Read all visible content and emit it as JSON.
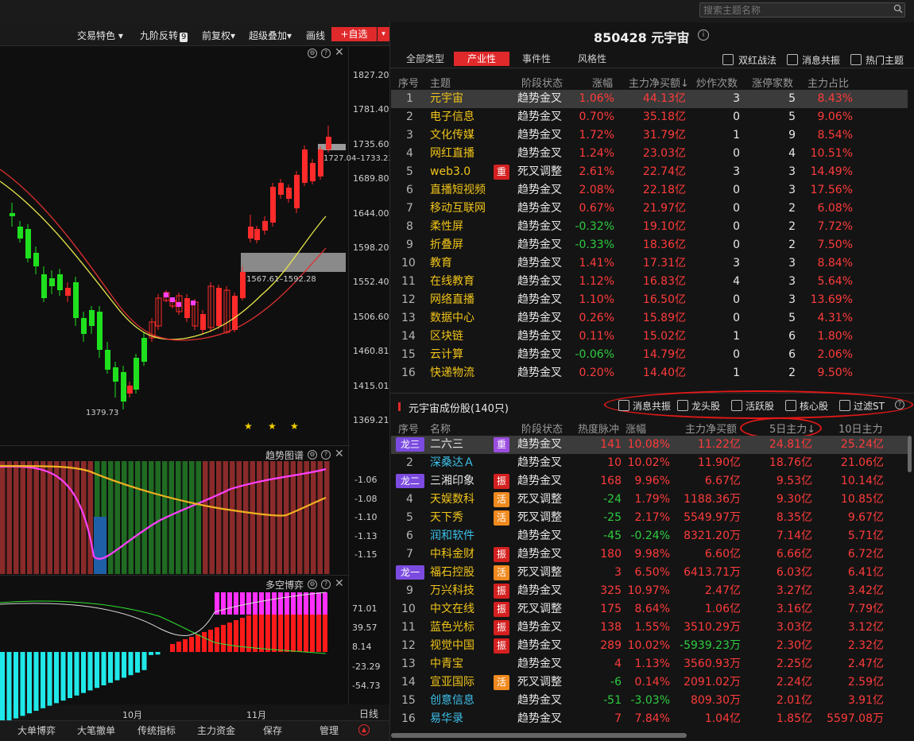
{
  "search": {
    "placeholder": "搜索主题名称"
  },
  "toolbar": {
    "items": [
      "交易特色 ▾",
      "九阶反转",
      "前复权▾",
      "超级叠加▾",
      "画线"
    ],
    "badge": "9",
    "add_label": "+自选",
    "add_dd": "▾"
  },
  "stock": {
    "code_name": "850428 元宇宙"
  },
  "tabs": [
    "全部类型",
    "产业性",
    "事件性",
    "风格性"
  ],
  "filters_top": [
    "双红战法",
    "消息共振",
    "热门主题"
  ],
  "theme_table": {
    "headers": [
      "序号",
      "主题",
      "阶段状态",
      "涨幅",
      "主力净买额↓",
      "炒作次数",
      "涨停家数",
      "主力占比"
    ],
    "rows": [
      {
        "no": "1",
        "name": "元宇宙",
        "tag": "",
        "state": "趋势金叉",
        "chg": "1.06%",
        "net": "44.13亿",
        "times": "3",
        "limit": "5",
        "ratio": "8.43%"
      },
      {
        "no": "2",
        "name": "电子信息",
        "tag": "",
        "state": "趋势金叉",
        "chg": "0.70%",
        "net": "35.18亿",
        "times": "0",
        "limit": "5",
        "ratio": "9.06%"
      },
      {
        "no": "3",
        "name": "文化传媒",
        "tag": "",
        "state": "趋势金叉",
        "chg": "1.72%",
        "net": "31.79亿",
        "times": "1",
        "limit": "9",
        "ratio": "8.54%"
      },
      {
        "no": "4",
        "name": "网红直播",
        "tag": "",
        "state": "趋势金叉",
        "chg": "1.24%",
        "net": "23.03亿",
        "times": "0",
        "limit": "4",
        "ratio": "10.51%"
      },
      {
        "no": "5",
        "name": "web3.0",
        "tag": "重",
        "state": "死叉调整",
        "chg": "2.61%",
        "net": "22.74亿",
        "times": "3",
        "limit": "3",
        "ratio": "14.49%"
      },
      {
        "no": "6",
        "name": "直播短视频",
        "tag": "",
        "state": "趋势金叉",
        "chg": "2.08%",
        "net": "22.18亿",
        "times": "0",
        "limit": "3",
        "ratio": "17.56%"
      },
      {
        "no": "7",
        "name": "移动互联网",
        "tag": "",
        "state": "趋势金叉",
        "chg": "0.67%",
        "net": "21.97亿",
        "times": "0",
        "limit": "2",
        "ratio": "6.08%"
      },
      {
        "no": "8",
        "name": "柔性屏",
        "tag": "",
        "state": "趋势金叉",
        "chg": "-0.32%",
        "net": "19.10亿",
        "times": "0",
        "limit": "2",
        "ratio": "7.72%"
      },
      {
        "no": "9",
        "name": "折叠屏",
        "tag": "",
        "state": "趋势金叉",
        "chg": "-0.33%",
        "net": "18.36亿",
        "times": "0",
        "limit": "2",
        "ratio": "7.50%"
      },
      {
        "no": "10",
        "name": "教育",
        "tag": "",
        "state": "趋势金叉",
        "chg": "1.41%",
        "net": "17.31亿",
        "times": "3",
        "limit": "3",
        "ratio": "8.84%"
      },
      {
        "no": "11",
        "name": "在线教育",
        "tag": "",
        "state": "趋势金叉",
        "chg": "1.12%",
        "net": "16.83亿",
        "times": "4",
        "limit": "3",
        "ratio": "5.64%"
      },
      {
        "no": "12",
        "name": "网络直播",
        "tag": "",
        "state": "趋势金叉",
        "chg": "1.10%",
        "net": "16.50亿",
        "times": "0",
        "limit": "3",
        "ratio": "13.69%"
      },
      {
        "no": "13",
        "name": "数据中心",
        "tag": "",
        "state": "趋势金叉",
        "chg": "0.26%",
        "net": "15.89亿",
        "times": "0",
        "limit": "5",
        "ratio": "4.31%"
      },
      {
        "no": "14",
        "name": "区块链",
        "tag": "",
        "state": "趋势金叉",
        "chg": "0.11%",
        "net": "15.02亿",
        "times": "1",
        "limit": "6",
        "ratio": "1.80%"
      },
      {
        "no": "15",
        "name": "云计算",
        "tag": "",
        "state": "趋势金叉",
        "chg": "-0.06%",
        "net": "14.79亿",
        "times": "0",
        "limit": "6",
        "ratio": "2.06%"
      },
      {
        "no": "16",
        "name": "快递物流",
        "tag": "",
        "state": "趋势金叉",
        "chg": "0.20%",
        "net": "14.40亿",
        "times": "1",
        "limit": "2",
        "ratio": "9.50%"
      }
    ]
  },
  "constituents": {
    "title": "元宇宙成份股(140只)",
    "filters": [
      "消息共振",
      "龙头股",
      "活跃股",
      "核心股",
      "过滤ST"
    ],
    "headers": [
      "序号",
      "名称",
      "阶段状态",
      "热度脉冲",
      "涨幅",
      "主力净买额",
      "5日主力↓",
      "10日主力"
    ],
    "rows": [
      {
        "no": "龙三",
        "name": "二六三",
        "nc": "white",
        "tag": "重",
        "tc": "p",
        "state": "趋势金叉",
        "heat": "141",
        "chg": "10.08%",
        "net": "11.22亿",
        "d5": "24.81亿",
        "d10": "25.24亿"
      },
      {
        "no": "2",
        "name": "深桑达Ａ",
        "nc": "cyan",
        "tag": "",
        "tc": "",
        "state": "趋势金叉",
        "heat": "10",
        "chg": "10.02%",
        "net": "11.90亿",
        "d5": "18.76亿",
        "d10": "21.06亿"
      },
      {
        "no": "龙二",
        "name": "三湘印象",
        "nc": "white",
        "tag": "振",
        "tc": "r",
        "state": "趋势金叉",
        "heat": "168",
        "chg": "9.96%",
        "net": "6.67亿",
        "d5": "9.53亿",
        "d10": "10.14亿"
      },
      {
        "no": "4",
        "name": "天娱数科",
        "nc": "yellow",
        "tag": "活",
        "tc": "o",
        "state": "死叉调整",
        "heat": "-24",
        "chg": "1.79%",
        "net": "1188.36万",
        "d5": "9.30亿",
        "d10": "10.85亿"
      },
      {
        "no": "5",
        "name": "天下秀",
        "nc": "yellow",
        "tag": "活",
        "tc": "o",
        "state": "死叉调整",
        "heat": "-25",
        "chg": "2.17%",
        "net": "5549.97万",
        "d5": "8.35亿",
        "d10": "9.67亿"
      },
      {
        "no": "6",
        "name": "润和软件",
        "nc": "cyan",
        "tag": "",
        "tc": "",
        "state": "趋势金叉",
        "heat": "-45",
        "chg": "-0.24%",
        "net": "8321.20万",
        "d5": "7.14亿",
        "d10": "5.71亿"
      },
      {
        "no": "7",
        "name": "中科金财",
        "nc": "yellow",
        "tag": "振",
        "tc": "r",
        "state": "趋势金叉",
        "heat": "180",
        "chg": "9.98%",
        "net": "6.60亿",
        "d5": "6.66亿",
        "d10": "6.72亿"
      },
      {
        "no": "龙一",
        "name": "福石控股",
        "nc": "yellow",
        "tag": "活",
        "tc": "o",
        "state": "死叉调整",
        "heat": "3",
        "chg": "6.50%",
        "net": "6413.71万",
        "d5": "6.03亿",
        "d10": "6.41亿"
      },
      {
        "no": "9",
        "name": "万兴科技",
        "nc": "yellow",
        "tag": "振",
        "tc": "r",
        "state": "趋势金叉",
        "heat": "325",
        "chg": "10.97%",
        "net": "2.47亿",
        "d5": "3.27亿",
        "d10": "3.42亿"
      },
      {
        "no": "10",
        "name": "中文在线",
        "nc": "yellow",
        "tag": "振",
        "tc": "r",
        "state": "死叉调整",
        "heat": "175",
        "chg": "8.64%",
        "net": "1.06亿",
        "d5": "3.16亿",
        "d10": "7.79亿"
      },
      {
        "no": "11",
        "name": "蓝色光标",
        "nc": "yellow",
        "tag": "振",
        "tc": "r",
        "state": "趋势金叉",
        "heat": "138",
        "chg": "1.55%",
        "net": "3510.29万",
        "d5": "3.03亿",
        "d10": "3.12亿"
      },
      {
        "no": "12",
        "name": "视觉中国",
        "nc": "yellow",
        "tag": "振",
        "tc": "r",
        "state": "趋势金叉",
        "heat": "289",
        "chg": "10.02%",
        "net": "-5939.23万",
        "d5": "2.30亿",
        "d10": "2.32亿"
      },
      {
        "no": "13",
        "name": "中青宝",
        "nc": "yellow",
        "tag": "",
        "tc": "",
        "state": "趋势金叉",
        "heat": "4",
        "chg": "1.13%",
        "net": "3560.93万",
        "d5": "2.25亿",
        "d10": "2.47亿"
      },
      {
        "no": "14",
        "name": "宣亚国际",
        "nc": "yellow",
        "tag": "活",
        "tc": "o",
        "state": "死叉调整",
        "heat": "-6",
        "chg": "0.14%",
        "net": "2091.02万",
        "d5": "2.24亿",
        "d10": "2.59亿"
      },
      {
        "no": "15",
        "name": "创意信息",
        "nc": "cyan",
        "tag": "",
        "tc": "",
        "state": "趋势金叉",
        "heat": "-51",
        "chg": "-3.03%",
        "net": "809.30万",
        "d5": "2.01亿",
        "d10": "3.91亿"
      },
      {
        "no": "16",
        "name": "易华录",
        "nc": "cyan",
        "tag": "",
        "tc": "",
        "state": "趋势金叉",
        "heat": "7",
        "chg": "7.84%",
        "net": "1.04亿",
        "d5": "1.85亿",
        "d10": "5597.08万"
      }
    ]
  },
  "kline": {
    "price_axis": [
      "1827.20",
      "1781.40",
      "1735.60",
      "1689.80",
      "1644.00",
      "1598.20",
      "1552.40",
      "1506.60",
      "1460.81",
      "1415.01",
      "1369.21"
    ],
    "label_high_zone": "1727.04–1733.23",
    "label_low_zone": "1567.61–1592.28",
    "label_low": "1379.73",
    "stars": "★"
  },
  "panel_trend": {
    "title": "趋势图谱",
    "axis": [
      "-1.06",
      "-1.08",
      "-1.10",
      "-1.13",
      "-1.15"
    ]
  },
  "panel_duokong": {
    "title": "多空博弈",
    "axis": [
      "71.01",
      "39.57",
      "8.14",
      "-23.29",
      "-54.73"
    ]
  },
  "time_axis": [
    "10月",
    "11月"
  ],
  "period": "日线",
  "bottom_tabs": [
    "大单博弈",
    "大笔撤单",
    "传统指标",
    "主力资金",
    "保存",
    "管理"
  ],
  "icons": {
    "settings": "⚙",
    "help": "?",
    "close": "✕",
    "info": "i"
  }
}
